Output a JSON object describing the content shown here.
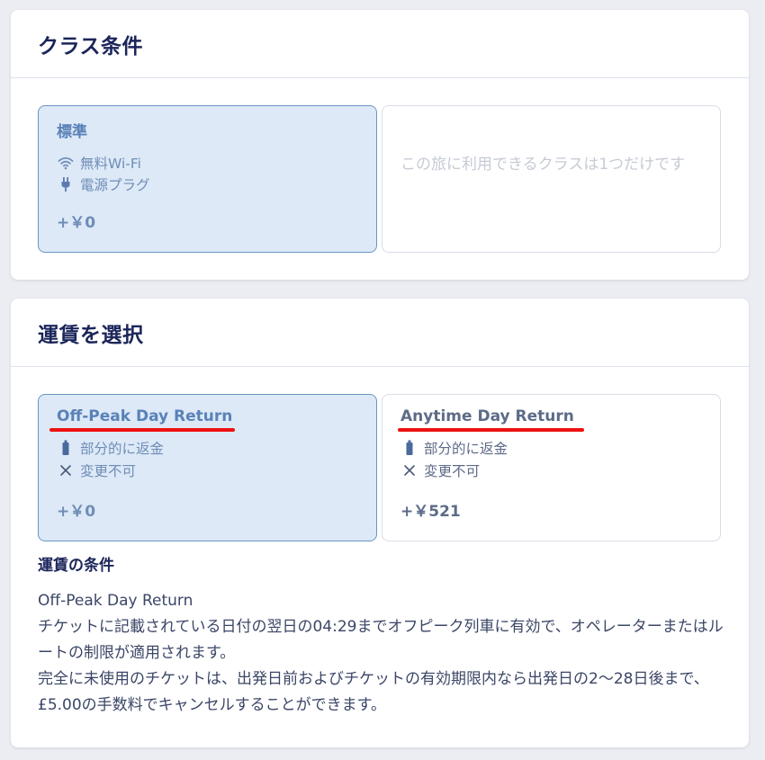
{
  "class_section": {
    "title": "クラス条件",
    "options": [
      {
        "name": "標準",
        "features": [
          {
            "icon": "wifi-icon",
            "label": "無料Wi-Fi"
          },
          {
            "icon": "plug-icon",
            "label": "電源プラグ"
          }
        ],
        "price": "+￥0",
        "selected": true
      }
    ],
    "only_one_message": "この旅に利用できるクラスは1つだけです"
  },
  "fare_section": {
    "title": "運賃を選択",
    "options": [
      {
        "name": "Off-Peak Day Return",
        "features": [
          {
            "icon": "ticket-icon",
            "label": "部分的に返金"
          },
          {
            "icon": "cross-icon",
            "label": "変更不可"
          }
        ],
        "price": "+￥0",
        "selected": true
      },
      {
        "name": "Anytime Day Return",
        "features": [
          {
            "icon": "ticket-icon",
            "label": "部分的に返金"
          },
          {
            "icon": "cross-icon",
            "label": "変更不可"
          }
        ],
        "price": "+￥521",
        "selected": false
      }
    ],
    "conditions_title": "運賃の条件",
    "conditions_lines": [
      "Off-Peak Day Return",
      "チケットに記載されている日付の翌日の04:29までオフピーク列車に有効で、オペレーターまたはルートの制限が適用されます。",
      "完全に未使用のチケットは、出発日前およびチケットの有効期限内なら出発日の2〜28日後まで、£5.00の手数料でキャンセルすることができます。"
    ]
  },
  "colors": {
    "selected_bg": "#dde9f7",
    "selected_border": "#6b94c5",
    "annotation_underline": "#ee1111",
    "heading": "#1b2559"
  }
}
